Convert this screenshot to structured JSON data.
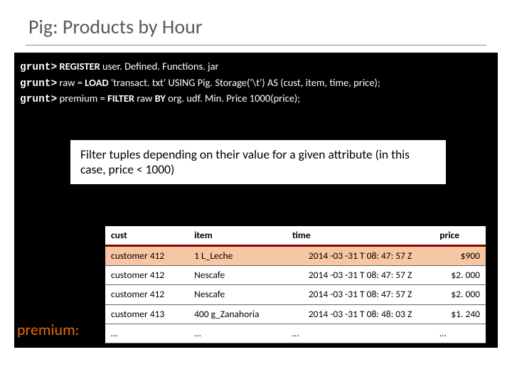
{
  "title": "Pig: Products by Hour",
  "terminal": {
    "prompt": "grunt>",
    "lines": [
      {
        "pre": "",
        "bold": "REGISTER",
        "post": " user. Defined. Functions. jar"
      },
      {
        "pre": "raw = ",
        "bold": "LOAD",
        "post": " 'transact. txt' USING Pig. Storage('\\t') AS (cust, item, time, price);"
      },
      {
        "pre": "premium = ",
        "bold": "FILTER",
        "mid": " raw ",
        "bold2": "BY",
        "post": " org. udf. Min. Price 1000(price);"
      }
    ]
  },
  "callout": "Filter tuples depending on their value for a given attribute (in this case, price < 1000)",
  "table_label": "premium:",
  "columns": [
    "cust",
    "item",
    "time",
    "price"
  ],
  "rows": [
    {
      "cust": "customer 412",
      "item": "1 L_Leche",
      "time": "2014 -03 -31 T 08: 47: 57 Z",
      "price": "$900"
    },
    {
      "cust": "customer 412",
      "item": "Nescafe",
      "time": "2014 -03 -31 T 08: 47: 57 Z",
      "price": "$2. 000"
    },
    {
      "cust": "customer 412",
      "item": "Nescafe",
      "time": "2014 -03 -31 T 08: 47: 57 Z",
      "price": "$2. 000"
    },
    {
      "cust": "customer 413",
      "item": "400 g_Zanahoria",
      "time": "2014 -03 -31 T 08: 48: 03 Z",
      "price": "$1. 240"
    },
    {
      "cust": "…",
      "item": "…",
      "time": "…",
      "price": "…"
    }
  ]
}
